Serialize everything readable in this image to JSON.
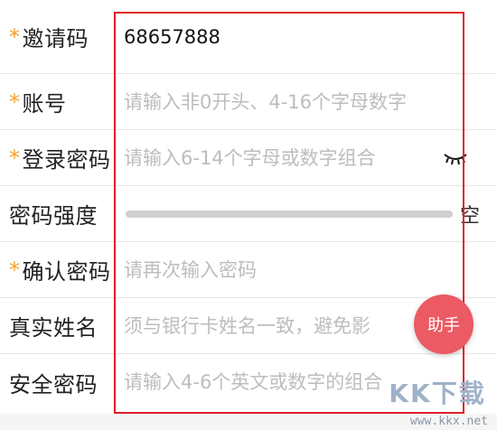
{
  "form": {
    "rows": [
      {
        "label": "邀请码",
        "required": true,
        "value": "68657888",
        "placeholder": ""
      },
      {
        "label": "账号",
        "required": true,
        "value": "",
        "placeholder": "请输入非0开头、4-16个字母数字"
      },
      {
        "label": "登录密码",
        "required": true,
        "value": "",
        "placeholder": "请输入6-14个字母或数字组合"
      },
      {
        "label": "密码强度",
        "required": false,
        "strength_text": "空",
        "strength_level": 0
      },
      {
        "label": "确认密码",
        "required": true,
        "value": "",
        "placeholder": "请再次输入密码"
      },
      {
        "label": "真实姓名",
        "required": false,
        "value": "",
        "placeholder": "须与银行卡姓名一致，避免影"
      },
      {
        "label": "安全密码",
        "required": false,
        "value": "",
        "placeholder": "请输入4-6个英文或数字的组合"
      }
    ],
    "required_mark": "*"
  },
  "helper_button": {
    "label": "助手"
  },
  "watermark": {
    "logo": "KK下载",
    "url": "www.kkx.net"
  },
  "colors": {
    "required": "#f0a030",
    "highlight_border": "#e0202a",
    "helper_bg": "#ec5a63"
  }
}
